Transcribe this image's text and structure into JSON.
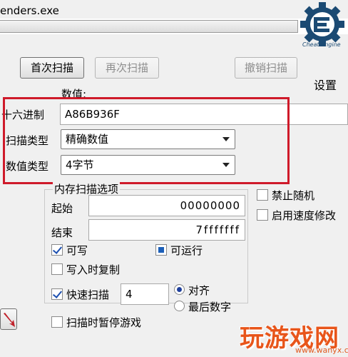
{
  "window": {
    "process_name": "enders.exe"
  },
  "toolbar": {
    "first_scan": "首次扫描",
    "next_scan": "再次扫描",
    "undo_scan": "撤销扫描",
    "settings": "设置",
    "logo_text": "Cheat Engine"
  },
  "value": {
    "label": "数值:",
    "hex_label": "十六进制",
    "input_value": "A86B936F"
  },
  "scan_type": {
    "label": "扫描类型",
    "selected": "精确数值"
  },
  "value_type": {
    "label": "数值类型",
    "selected": "4字节"
  },
  "memory_options": {
    "title": "内存扫描选项",
    "start_label": "起始",
    "start_value": "00000000",
    "end_label": "结束",
    "end_value": "7fffffff",
    "writable_label": "可写",
    "writable": true,
    "executable_label": "可运行",
    "executable": "partial",
    "copy_on_write_label": "写入时复制",
    "copy_on_write": false,
    "fast_scan_label": "快速扫描",
    "fast_scan": true,
    "fast_scan_value": "4",
    "align_label": "对齐",
    "last_digits_label": "最后数字",
    "alignment_mode": "对齐",
    "pause_label": "扫描时暂停游戏",
    "pause": false
  },
  "right_options": {
    "disable_random_label": "禁止随机",
    "speedhack_label": "启用速度修改"
  },
  "watermark": {
    "brand": "玩游戏网",
    "url": "www.wanyx.com"
  },
  "colors": {
    "highlight": "#cf1a2a",
    "logo": "#1b4a73",
    "watermark": "#e8551a"
  }
}
